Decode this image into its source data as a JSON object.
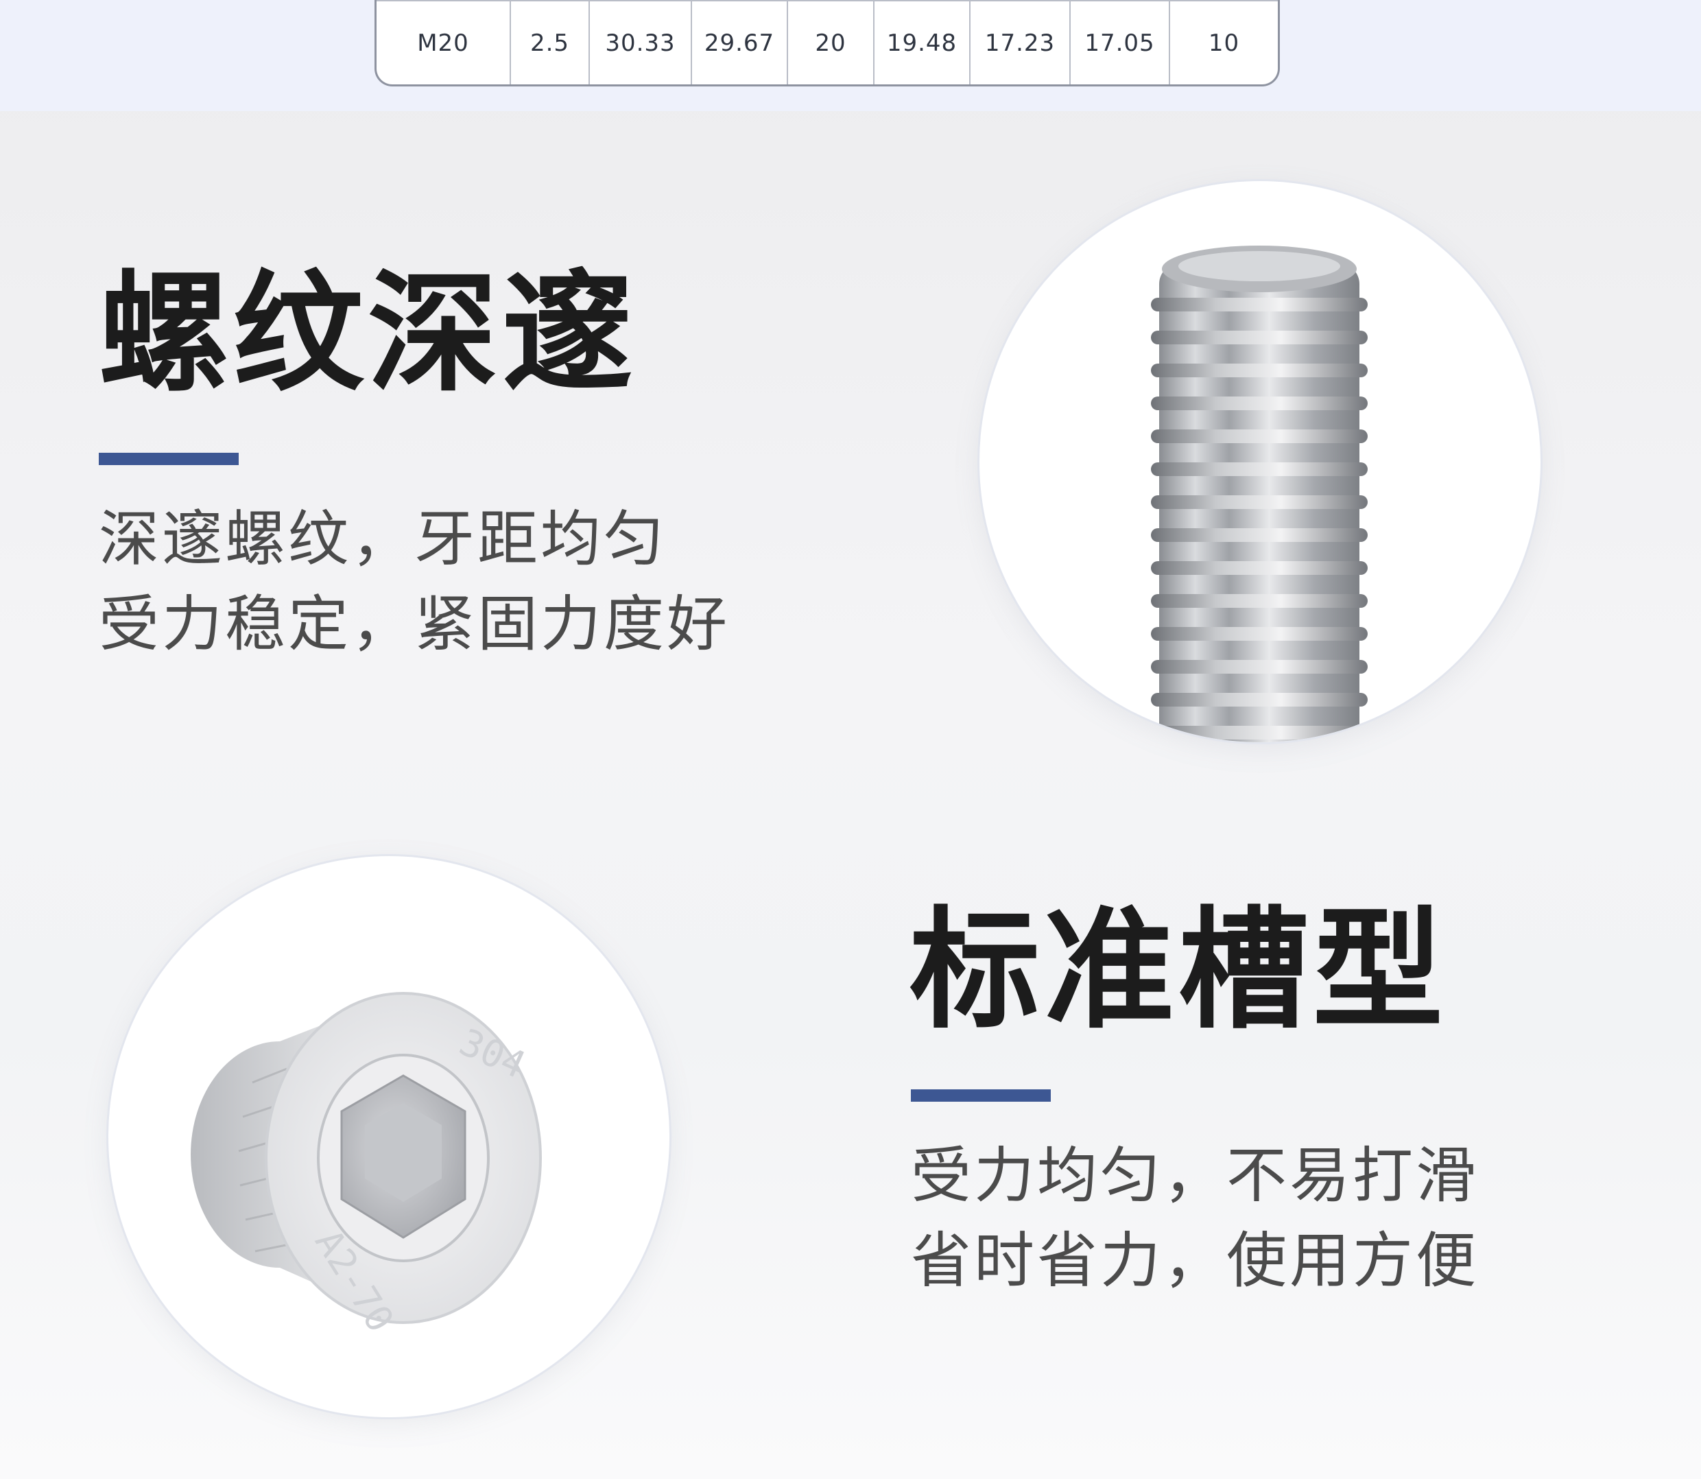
{
  "spec_table": {
    "row": [
      "M20",
      "2.5",
      "30.33",
      "29.67",
      "20",
      "19.48",
      "17.23",
      "17.05",
      "10"
    ]
  },
  "feature1": {
    "title": "螺纹深邃",
    "desc_line1": "深邃螺纹，牙距均匀",
    "desc_line2": "受力稳定，紧固力度好"
  },
  "feature2": {
    "title": "标准槽型",
    "desc_line1": "受力均匀，不易打滑",
    "desc_line2": "省时省力，使用方便"
  },
  "screw_head": {
    "marking_top": "304",
    "marking_bottom": "A2-70"
  },
  "colors": {
    "accent": "#3d5793",
    "title": "#1c1c1c",
    "text": "#4b4b4b"
  }
}
